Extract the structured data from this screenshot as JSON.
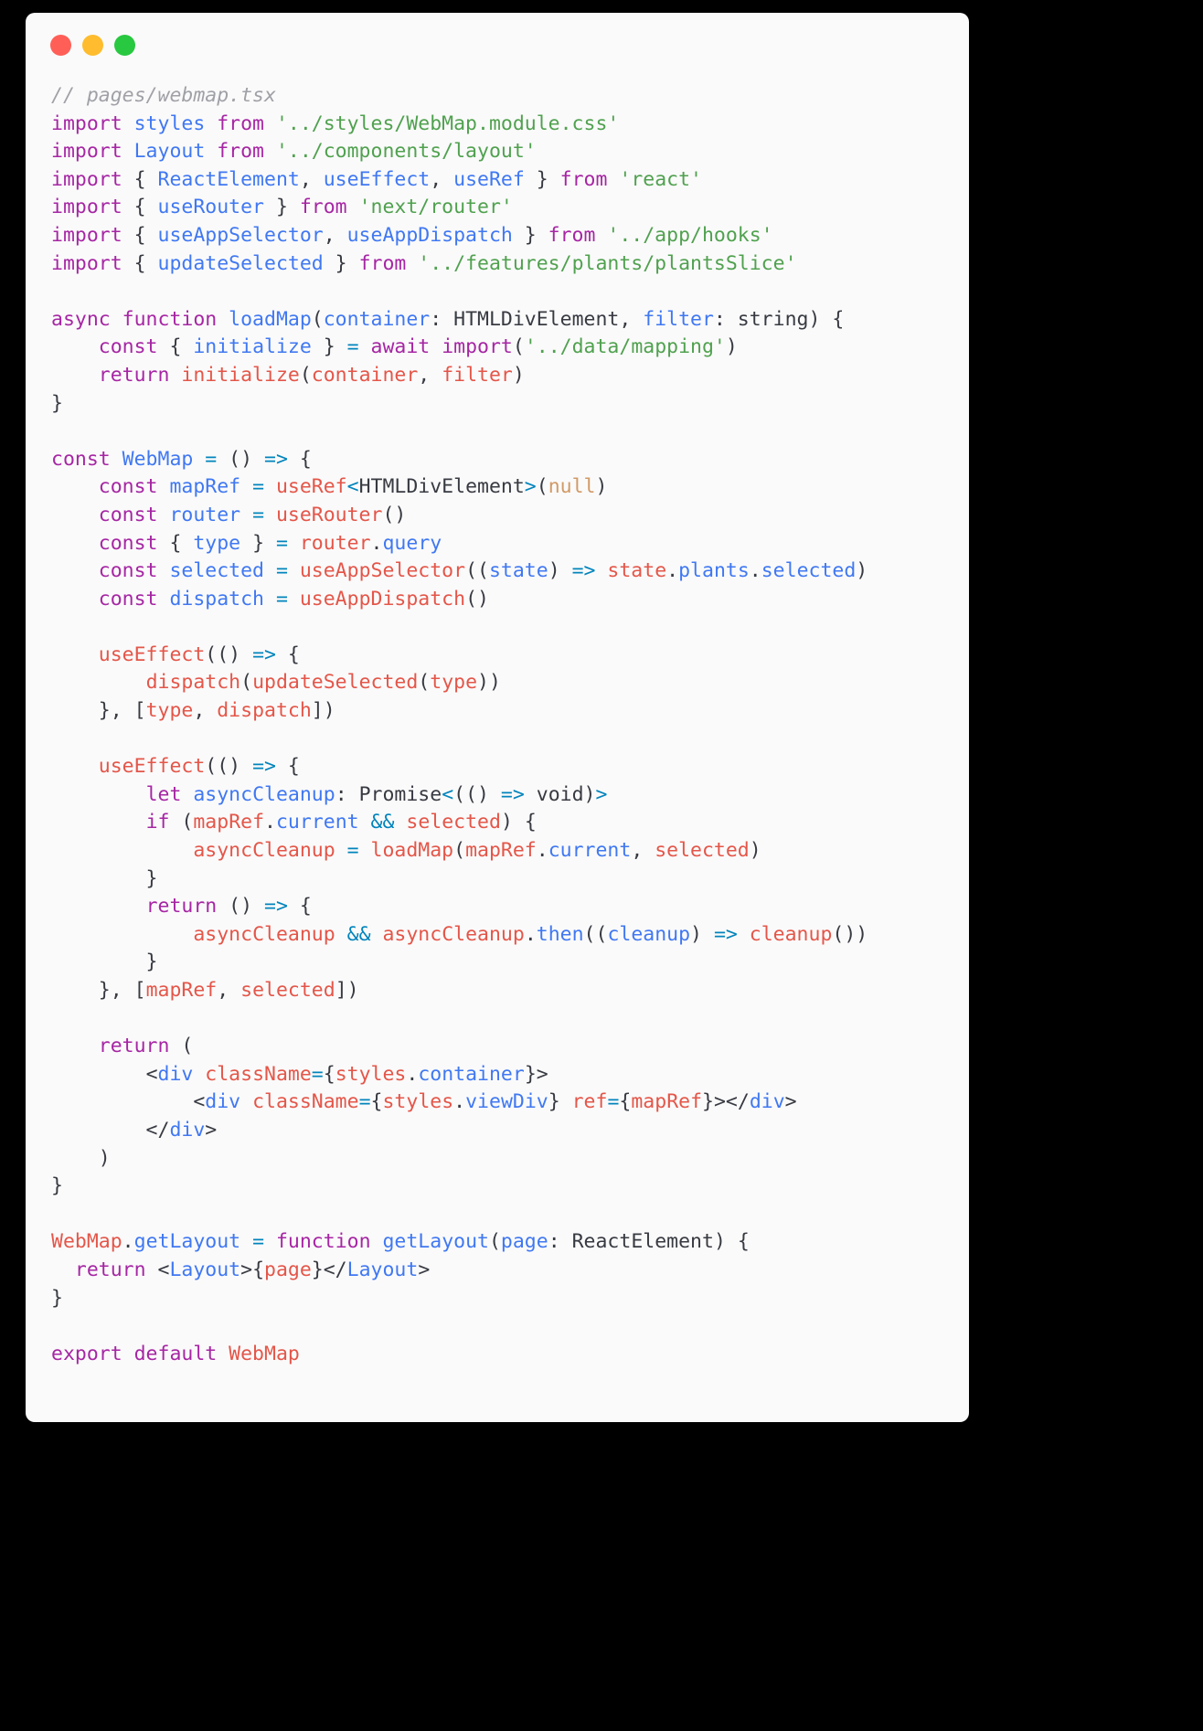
{
  "window": {
    "traffic_lights": [
      {
        "name": "close-button",
        "color": "#ff5f57"
      },
      {
        "name": "minimize-button",
        "color": "#febc2e"
      },
      {
        "name": "maximize-button",
        "color": "#28c840"
      }
    ],
    "background": "#fafafa",
    "page_background": "#000000"
  },
  "theme": {
    "comment": "#a0a1a7",
    "keyword": "#a626a4",
    "identifier": "#4078f2",
    "string": "#50a14f",
    "call": "#e45649",
    "operator": "#0184bc",
    "type": "#383a42",
    "constant": "#d19a66"
  },
  "code": {
    "language": "tsx",
    "filename": "pages/webmap.tsx",
    "plain_text": "// pages/webmap.tsx\nimport styles from '../styles/WebMap.module.css'\nimport Layout from '../components/layout'\nimport { ReactElement, useEffect, useRef } from 'react'\nimport { useRouter } from 'next/router'\nimport { useAppSelector, useAppDispatch } from '../app/hooks'\nimport { updateSelected } from '../features/plants/plantsSlice'\n\nasync function loadMap(container: HTMLDivElement, filter: string) {\n    const { initialize } = await import('../data/mapping')\n    return initialize(container, filter)\n}\n\nconst WebMap = () => {\n    const mapRef = useRef<HTMLDivElement>(null)\n    const router = useRouter()\n    const { type } = router.query\n    const selected = useAppSelector((state) => state.plants.selected)\n    const dispatch = useAppDispatch()\n\n    useEffect(() => {\n        dispatch(updateSelected(type))\n    }, [type, dispatch])\n\n    useEffect(() => {\n        let asyncCleanup: Promise<(() => void)>\n        if (mapRef.current && selected) {\n            asyncCleanup = loadMap(mapRef.current, selected)\n        }\n        return () => {\n            asyncCleanup && asyncCleanup.then((cleanup) => cleanup())\n        }\n    }, [mapRef, selected])\n\n    return (\n        <div className={styles.container}>\n            <div className={styles.viewDiv} ref={mapRef}></div>\n        </div>\n    )\n}\n\nWebMap.getLayout = function getLayout(page: ReactElement) {\n  return <Layout>{page}</Layout>\n}\n\nexport default WebMap",
    "lines": [
      [
        {
          "t": "// pages/webmap.tsx",
          "c": "cm"
        }
      ],
      [
        {
          "t": "import ",
          "c": "kw"
        },
        {
          "t": "styles ",
          "c": "id"
        },
        {
          "t": "from ",
          "c": "kw"
        },
        {
          "t": "'../styles/WebMap.module.css'",
          "c": "st"
        }
      ],
      [
        {
          "t": "import ",
          "c": "kw"
        },
        {
          "t": "Layout ",
          "c": "id"
        },
        {
          "t": "from ",
          "c": "kw"
        },
        {
          "t": "'../components/layout'",
          "c": "st"
        }
      ],
      [
        {
          "t": "import ",
          "c": "kw"
        },
        {
          "t": "{ ",
          "c": "pn"
        },
        {
          "t": "ReactElement",
          "c": "id"
        },
        {
          "t": ", ",
          "c": "pn"
        },
        {
          "t": "useEffect",
          "c": "id"
        },
        {
          "t": ", ",
          "c": "pn"
        },
        {
          "t": "useRef",
          "c": "id"
        },
        {
          "t": " } ",
          "c": "pn"
        },
        {
          "t": "from ",
          "c": "kw"
        },
        {
          "t": "'react'",
          "c": "st"
        }
      ],
      [
        {
          "t": "import ",
          "c": "kw"
        },
        {
          "t": "{ ",
          "c": "pn"
        },
        {
          "t": "useRouter",
          "c": "id"
        },
        {
          "t": " } ",
          "c": "pn"
        },
        {
          "t": "from ",
          "c": "kw"
        },
        {
          "t": "'next/router'",
          "c": "st"
        }
      ],
      [
        {
          "t": "import ",
          "c": "kw"
        },
        {
          "t": "{ ",
          "c": "pn"
        },
        {
          "t": "useAppSelector",
          "c": "id"
        },
        {
          "t": ", ",
          "c": "pn"
        },
        {
          "t": "useAppDispatch",
          "c": "id"
        },
        {
          "t": " } ",
          "c": "pn"
        },
        {
          "t": "from ",
          "c": "kw"
        },
        {
          "t": "'../app/hooks'",
          "c": "st"
        }
      ],
      [
        {
          "t": "import ",
          "c": "kw"
        },
        {
          "t": "{ ",
          "c": "pn"
        },
        {
          "t": "updateSelected",
          "c": "id"
        },
        {
          "t": " } ",
          "c": "pn"
        },
        {
          "t": "from ",
          "c": "kw"
        },
        {
          "t": "'../features/plants/plantsSlice'",
          "c": "st"
        }
      ],
      [],
      [
        {
          "t": "async function ",
          "c": "kw"
        },
        {
          "t": "loadMap",
          "c": "id"
        },
        {
          "t": "(",
          "c": "pn"
        },
        {
          "t": "container",
          "c": "id"
        },
        {
          "t": ": ",
          "c": "pn"
        },
        {
          "t": "HTMLDivElement",
          "c": "ty"
        },
        {
          "t": ", ",
          "c": "pn"
        },
        {
          "t": "filter",
          "c": "id"
        },
        {
          "t": ": ",
          "c": "pn"
        },
        {
          "t": "string",
          "c": "ty"
        },
        {
          "t": ") {",
          "c": "pn"
        }
      ],
      [
        {
          "t": "    ",
          "c": "pn"
        },
        {
          "t": "const ",
          "c": "kw"
        },
        {
          "t": "{ ",
          "c": "pn"
        },
        {
          "t": "initialize",
          "c": "id"
        },
        {
          "t": " } ",
          "c": "pn"
        },
        {
          "t": "= ",
          "c": "op"
        },
        {
          "t": "await import",
          "c": "kw"
        },
        {
          "t": "(",
          "c": "pn"
        },
        {
          "t": "'../data/mapping'",
          "c": "st"
        },
        {
          "t": ")",
          "c": "pn"
        }
      ],
      [
        {
          "t": "    ",
          "c": "pn"
        },
        {
          "t": "return ",
          "c": "kw"
        },
        {
          "t": "initialize",
          "c": "fn"
        },
        {
          "t": "(",
          "c": "pn"
        },
        {
          "t": "container",
          "c": "fn"
        },
        {
          "t": ", ",
          "c": "pn"
        },
        {
          "t": "filter",
          "c": "fn"
        },
        {
          "t": ")",
          "c": "pn"
        }
      ],
      [
        {
          "t": "}",
          "c": "pn"
        }
      ],
      [],
      [
        {
          "t": "const ",
          "c": "kw"
        },
        {
          "t": "WebMap ",
          "c": "id"
        },
        {
          "t": "= ",
          "c": "op"
        },
        {
          "t": "() ",
          "c": "pn"
        },
        {
          "t": "=> ",
          "c": "op"
        },
        {
          "t": "{",
          "c": "pn"
        }
      ],
      [
        {
          "t": "    ",
          "c": "pn"
        },
        {
          "t": "const ",
          "c": "kw"
        },
        {
          "t": "mapRef ",
          "c": "id"
        },
        {
          "t": "= ",
          "c": "op"
        },
        {
          "t": "useRef",
          "c": "fn"
        },
        {
          "t": "<",
          "c": "op"
        },
        {
          "t": "HTMLDivElement",
          "c": "ty"
        },
        {
          "t": ">",
          "c": "op"
        },
        {
          "t": "(",
          "c": "pn"
        },
        {
          "t": "null",
          "c": "nu"
        },
        {
          "t": ")",
          "c": "pn"
        }
      ],
      [
        {
          "t": "    ",
          "c": "pn"
        },
        {
          "t": "const ",
          "c": "kw"
        },
        {
          "t": "router ",
          "c": "id"
        },
        {
          "t": "= ",
          "c": "op"
        },
        {
          "t": "useRouter",
          "c": "fn"
        },
        {
          "t": "()",
          "c": "pn"
        }
      ],
      [
        {
          "t": "    ",
          "c": "pn"
        },
        {
          "t": "const ",
          "c": "kw"
        },
        {
          "t": "{ ",
          "c": "pn"
        },
        {
          "t": "type",
          "c": "id"
        },
        {
          "t": " } ",
          "c": "pn"
        },
        {
          "t": "= ",
          "c": "op"
        },
        {
          "t": "router",
          "c": "fn"
        },
        {
          "t": ".",
          "c": "pn"
        },
        {
          "t": "query",
          "c": "id"
        }
      ],
      [
        {
          "t": "    ",
          "c": "pn"
        },
        {
          "t": "const ",
          "c": "kw"
        },
        {
          "t": "selected ",
          "c": "id"
        },
        {
          "t": "= ",
          "c": "op"
        },
        {
          "t": "useAppSelector",
          "c": "fn"
        },
        {
          "t": "((",
          "c": "pn"
        },
        {
          "t": "state",
          "c": "id"
        },
        {
          "t": ") ",
          "c": "pn"
        },
        {
          "t": "=> ",
          "c": "op"
        },
        {
          "t": "state",
          "c": "fn"
        },
        {
          "t": ".",
          "c": "pn"
        },
        {
          "t": "plants",
          "c": "id"
        },
        {
          "t": ".",
          "c": "pn"
        },
        {
          "t": "selected",
          "c": "id"
        },
        {
          "t": ")",
          "c": "pn"
        }
      ],
      [
        {
          "t": "    ",
          "c": "pn"
        },
        {
          "t": "const ",
          "c": "kw"
        },
        {
          "t": "dispatch ",
          "c": "id"
        },
        {
          "t": "= ",
          "c": "op"
        },
        {
          "t": "useAppDispatch",
          "c": "fn"
        },
        {
          "t": "()",
          "c": "pn"
        }
      ],
      [],
      [
        {
          "t": "    ",
          "c": "pn"
        },
        {
          "t": "useEffect",
          "c": "fn"
        },
        {
          "t": "(() ",
          "c": "pn"
        },
        {
          "t": "=> ",
          "c": "op"
        },
        {
          "t": "{",
          "c": "pn"
        }
      ],
      [
        {
          "t": "        ",
          "c": "pn"
        },
        {
          "t": "dispatch",
          "c": "fn"
        },
        {
          "t": "(",
          "c": "pn"
        },
        {
          "t": "updateSelected",
          "c": "fn"
        },
        {
          "t": "(",
          "c": "pn"
        },
        {
          "t": "type",
          "c": "fn"
        },
        {
          "t": "))",
          "c": "pn"
        }
      ],
      [
        {
          "t": "    }, [",
          "c": "pn"
        },
        {
          "t": "type",
          "c": "fn"
        },
        {
          "t": ", ",
          "c": "pn"
        },
        {
          "t": "dispatch",
          "c": "fn"
        },
        {
          "t": "])",
          "c": "pn"
        }
      ],
      [],
      [
        {
          "t": "    ",
          "c": "pn"
        },
        {
          "t": "useEffect",
          "c": "fn"
        },
        {
          "t": "(() ",
          "c": "pn"
        },
        {
          "t": "=> ",
          "c": "op"
        },
        {
          "t": "{",
          "c": "pn"
        }
      ],
      [
        {
          "t": "        ",
          "c": "pn"
        },
        {
          "t": "let ",
          "c": "kw"
        },
        {
          "t": "asyncCleanup",
          "c": "id"
        },
        {
          "t": ": ",
          "c": "pn"
        },
        {
          "t": "Promise",
          "c": "ty"
        },
        {
          "t": "<",
          "c": "op"
        },
        {
          "t": "(() ",
          "c": "pn"
        },
        {
          "t": "=> ",
          "c": "op"
        },
        {
          "t": "void",
          "c": "ty"
        },
        {
          "t": ")",
          "c": "pn"
        },
        {
          "t": ">",
          "c": "op"
        }
      ],
      [
        {
          "t": "        ",
          "c": "pn"
        },
        {
          "t": "if ",
          "c": "kw"
        },
        {
          "t": "(",
          "c": "pn"
        },
        {
          "t": "mapRef",
          "c": "fn"
        },
        {
          "t": ".",
          "c": "pn"
        },
        {
          "t": "current ",
          "c": "id"
        },
        {
          "t": "&& ",
          "c": "op"
        },
        {
          "t": "selected",
          "c": "fn"
        },
        {
          "t": ") {",
          "c": "pn"
        }
      ],
      [
        {
          "t": "            ",
          "c": "pn"
        },
        {
          "t": "asyncCleanup ",
          "c": "fn"
        },
        {
          "t": "= ",
          "c": "op"
        },
        {
          "t": "loadMap",
          "c": "fn"
        },
        {
          "t": "(",
          "c": "pn"
        },
        {
          "t": "mapRef",
          "c": "fn"
        },
        {
          "t": ".",
          "c": "pn"
        },
        {
          "t": "current",
          "c": "id"
        },
        {
          "t": ", ",
          "c": "pn"
        },
        {
          "t": "selected",
          "c": "fn"
        },
        {
          "t": ")",
          "c": "pn"
        }
      ],
      [
        {
          "t": "        }",
          "c": "pn"
        }
      ],
      [
        {
          "t": "        ",
          "c": "pn"
        },
        {
          "t": "return ",
          "c": "kw"
        },
        {
          "t": "() ",
          "c": "pn"
        },
        {
          "t": "=> ",
          "c": "op"
        },
        {
          "t": "{",
          "c": "pn"
        }
      ],
      [
        {
          "t": "            ",
          "c": "pn"
        },
        {
          "t": "asyncCleanup ",
          "c": "fn"
        },
        {
          "t": "&& ",
          "c": "op"
        },
        {
          "t": "asyncCleanup",
          "c": "fn"
        },
        {
          "t": ".",
          "c": "pn"
        },
        {
          "t": "then",
          "c": "id"
        },
        {
          "t": "((",
          "c": "pn"
        },
        {
          "t": "cleanup",
          "c": "id"
        },
        {
          "t": ") ",
          "c": "pn"
        },
        {
          "t": "=> ",
          "c": "op"
        },
        {
          "t": "cleanup",
          "c": "fn"
        },
        {
          "t": "())",
          "c": "pn"
        }
      ],
      [
        {
          "t": "        }",
          "c": "pn"
        }
      ],
      [
        {
          "t": "    }, [",
          "c": "pn"
        },
        {
          "t": "mapRef",
          "c": "fn"
        },
        {
          "t": ", ",
          "c": "pn"
        },
        {
          "t": "selected",
          "c": "fn"
        },
        {
          "t": "])",
          "c": "pn"
        }
      ],
      [],
      [
        {
          "t": "    ",
          "c": "pn"
        },
        {
          "t": "return ",
          "c": "kw"
        },
        {
          "t": "(",
          "c": "pn"
        }
      ],
      [
        {
          "t": "        ",
          "c": "pn"
        },
        {
          "t": "<",
          "c": "pn"
        },
        {
          "t": "div ",
          "c": "id"
        },
        {
          "t": "className",
          "c": "fn"
        },
        {
          "t": "=",
          "c": "op"
        },
        {
          "t": "{",
          "c": "pn"
        },
        {
          "t": "styles",
          "c": "fn"
        },
        {
          "t": ".",
          "c": "pn"
        },
        {
          "t": "container",
          "c": "id"
        },
        {
          "t": "}>",
          "c": "pn"
        }
      ],
      [
        {
          "t": "            ",
          "c": "pn"
        },
        {
          "t": "<",
          "c": "pn"
        },
        {
          "t": "div ",
          "c": "id"
        },
        {
          "t": "className",
          "c": "fn"
        },
        {
          "t": "=",
          "c": "op"
        },
        {
          "t": "{",
          "c": "pn"
        },
        {
          "t": "styles",
          "c": "fn"
        },
        {
          "t": ".",
          "c": "pn"
        },
        {
          "t": "viewDiv",
          "c": "id"
        },
        {
          "t": "} ",
          "c": "pn"
        },
        {
          "t": "ref",
          "c": "fn"
        },
        {
          "t": "=",
          "c": "op"
        },
        {
          "t": "{",
          "c": "pn"
        },
        {
          "t": "mapRef",
          "c": "fn"
        },
        {
          "t": "}></",
          "c": "pn"
        },
        {
          "t": "div",
          "c": "id"
        },
        {
          "t": ">",
          "c": "pn"
        }
      ],
      [
        {
          "t": "        </",
          "c": "pn"
        },
        {
          "t": "div",
          "c": "id"
        },
        {
          "t": ">",
          "c": "pn"
        }
      ],
      [
        {
          "t": "    )",
          "c": "pn"
        }
      ],
      [
        {
          "t": "}",
          "c": "pn"
        }
      ],
      [],
      [
        {
          "t": "WebMap",
          "c": "fn"
        },
        {
          "t": ".",
          "c": "pn"
        },
        {
          "t": "getLayout ",
          "c": "id"
        },
        {
          "t": "= ",
          "c": "op"
        },
        {
          "t": "function ",
          "c": "kw"
        },
        {
          "t": "getLayout",
          "c": "id"
        },
        {
          "t": "(",
          "c": "pn"
        },
        {
          "t": "page",
          "c": "id"
        },
        {
          "t": ": ",
          "c": "pn"
        },
        {
          "t": "ReactElement",
          "c": "ty"
        },
        {
          "t": ") {",
          "c": "pn"
        }
      ],
      [
        {
          "t": "  ",
          "c": "pn"
        },
        {
          "t": "return ",
          "c": "kw"
        },
        {
          "t": "<",
          "c": "pn"
        },
        {
          "t": "Layout",
          "c": "id"
        },
        {
          "t": ">{",
          "c": "pn"
        },
        {
          "t": "page",
          "c": "fn"
        },
        {
          "t": "}</",
          "c": "pn"
        },
        {
          "t": "Layout",
          "c": "id"
        },
        {
          "t": ">",
          "c": "pn"
        }
      ],
      [
        {
          "t": "}",
          "c": "pn"
        }
      ],
      [],
      [
        {
          "t": "export default ",
          "c": "kw"
        },
        {
          "t": "WebMap",
          "c": "fn"
        }
      ]
    ]
  }
}
